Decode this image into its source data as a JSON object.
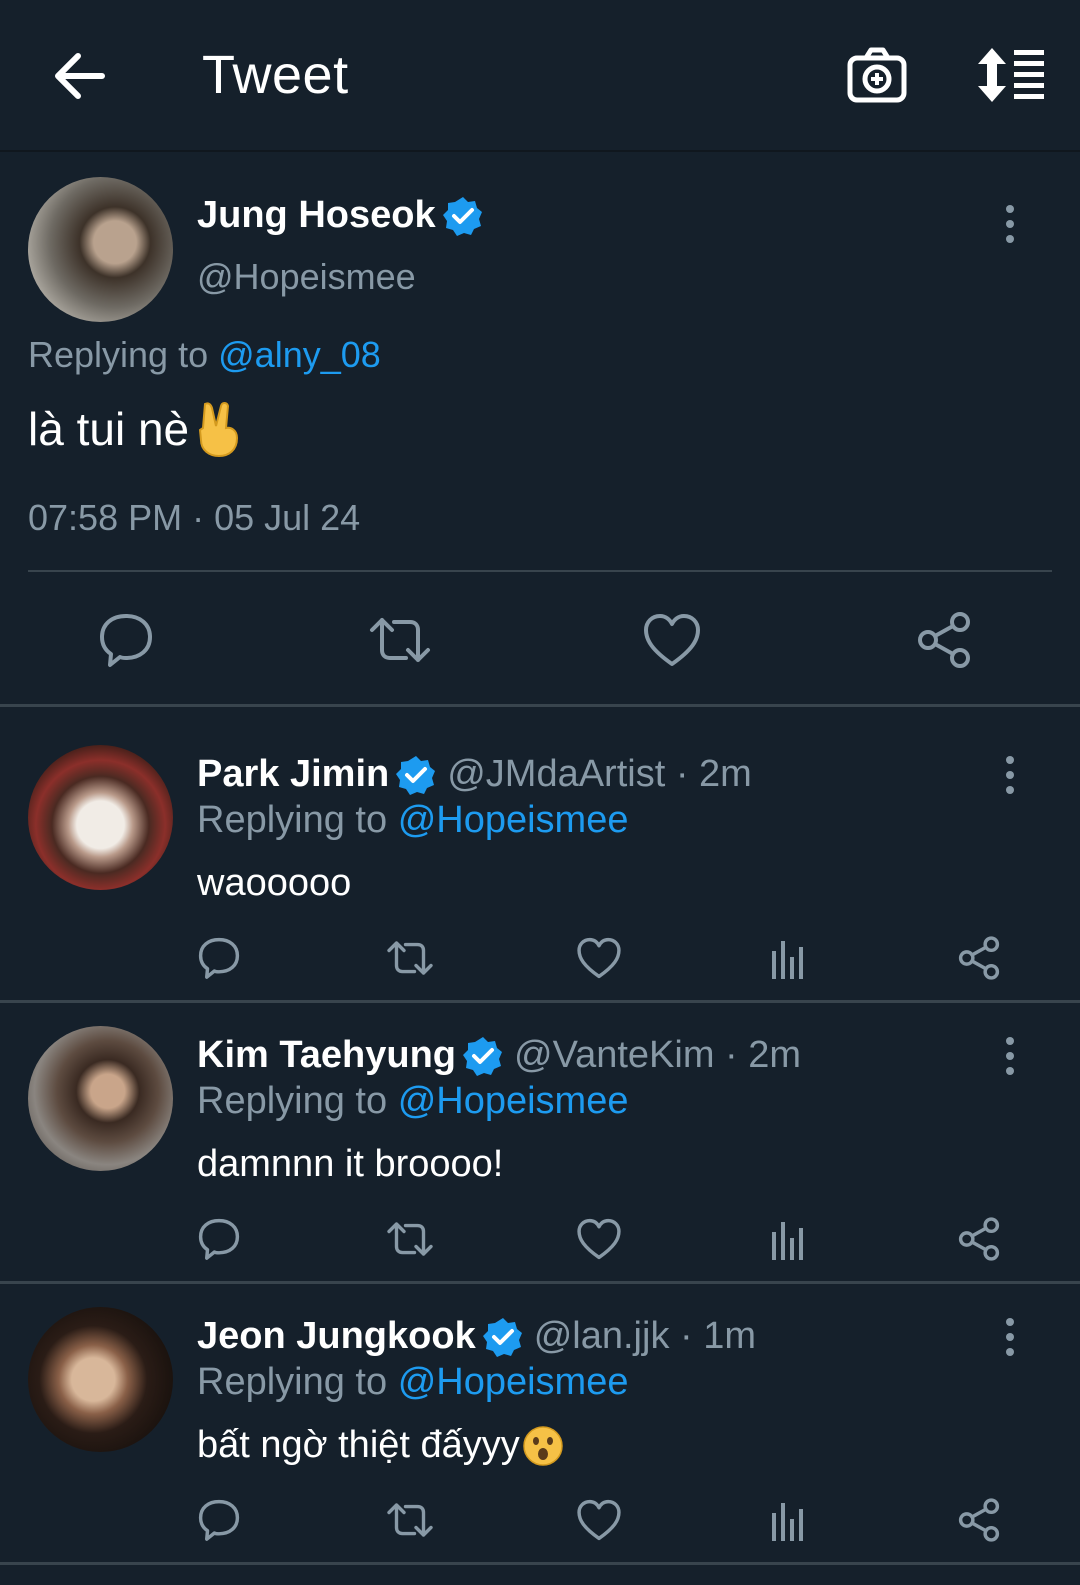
{
  "topbar": {
    "title": "Tweet",
    "icons": [
      "back-arrow-icon",
      "camera-plus-icon",
      "sort-icon"
    ]
  },
  "main_tweet": {
    "name": "Jung Hoseok",
    "handle": "@Hopeismee",
    "replying_label": "Replying to",
    "replying_to": "@alny_08",
    "text": "là tui nè",
    "emoji": "✌️",
    "timestamp": "07:58 PM · 05 Jul 24",
    "verified": true
  },
  "replies": [
    {
      "name": "Park Jimin",
      "meta": "@JMdaArtist · 2m",
      "replying_label": "Replying to",
      "replying_to": "@Hopeismee",
      "text": "waooooo",
      "emoji": "",
      "verified": true
    },
    {
      "name": "Kim Taehyung",
      "meta": "@VanteKim · 2m",
      "replying_label": "Replying to",
      "replying_to": "@Hopeismee",
      "text": "damnnn it broooo!",
      "emoji": "",
      "verified": true
    },
    {
      "name": "Jeon Jungkook",
      "meta": "@lan.jjk · 1m",
      "replying_label": "Replying to",
      "replying_to": "@Hopeismee",
      "text": "bất ngờ thiệt đấyyy",
      "emoji": "😮",
      "verified": true
    }
  ],
  "colors": {
    "background": "#15202b",
    "secondary_text": "#8899a6",
    "link": "#1d9bf0",
    "divider": "#38444d"
  }
}
